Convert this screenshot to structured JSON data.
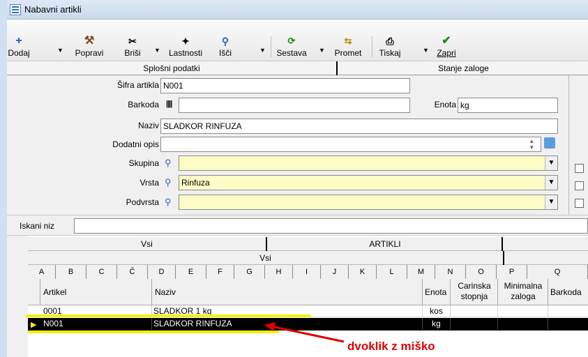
{
  "window": {
    "title": "Nabavni artikli"
  },
  "toolbar": {
    "dodaj": "Dodaj",
    "popravi": "Popravi",
    "brisi": "Briši",
    "lastnosti": "Lastnosti",
    "isci": "Išči",
    "sestava": "Sestava",
    "promet": "Promet",
    "tiskaj": "Tiskaj",
    "zapri": "Zapri"
  },
  "tabs": {
    "splosni": "Splošni podatki",
    "stanje": "Stanje zaloge"
  },
  "form": {
    "sifra_label": "Šifra artikla",
    "sifra_value": "N001",
    "barkoda_label": "Barkoda",
    "barkoda_value": "",
    "enota_label": "Enota",
    "enota_value": "kg",
    "naziv_label": "Naziv",
    "naziv_value": "SLADKOR RINFUZA",
    "dodatni_label": "Dodatni opis",
    "dodatni_value": "",
    "skupina_label": "Skupina",
    "skupina_value": "",
    "vrsta_label": "Vrsta",
    "vrsta_value": "Rinfuza",
    "podvrsta_label": "Podvrsta",
    "podvrsta_value": ""
  },
  "search": {
    "label": "Iskani niz",
    "value": ""
  },
  "grid": {
    "band1_left": "Vsi",
    "band1_right": "ARTIKLI",
    "band2": "Vsi",
    "letters": [
      "A",
      "B",
      "C",
      "Č",
      "D",
      "E",
      "F",
      "G",
      "H",
      "I",
      "J",
      "K",
      "L",
      "M",
      "N",
      "O",
      "P",
      "Q"
    ],
    "headers": {
      "artikel": "Artikel",
      "naziv": "Naziv",
      "enota": "Enota",
      "carinska": "Carinska stopnja",
      "minimalna": "Minimalna zaloga",
      "barkoda": "Barkoda"
    },
    "rows": [
      {
        "artikel": "0001",
        "naziv": "SLADKOR 1 kg",
        "enota": "kos"
      },
      {
        "artikel": "N001",
        "naziv": "SLADKOR RINFUZA",
        "enota": "kg"
      }
    ]
  },
  "annotation": {
    "text": "dvoklik z miško",
    "color": "#e00000",
    "highlight_color": "#f4f000"
  }
}
